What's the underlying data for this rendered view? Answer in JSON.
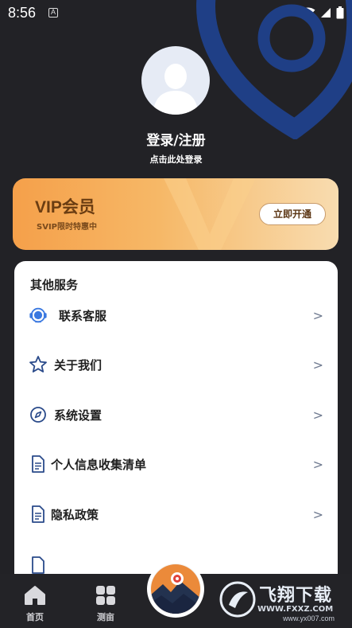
{
  "status": {
    "time": "8:56",
    "notification_icon": "A"
  },
  "profile": {
    "login_title": "登录/注册",
    "login_subtitle": "点击此处登录"
  },
  "vip": {
    "title": "VIP会员",
    "subtitle": "SVIP限时特惠中",
    "button": "立即开通"
  },
  "services": {
    "title": "其他服务",
    "items": [
      {
        "label": "联系客服",
        "icon": "headset-icon"
      },
      {
        "label": "关于我们",
        "icon": "star-icon"
      },
      {
        "label": "系统设置",
        "icon": "compass-icon"
      },
      {
        "label": "个人信息收集清单",
        "icon": "document-icon"
      },
      {
        "label": "隐私政策",
        "icon": "document-icon"
      }
    ],
    "chevron": ">"
  },
  "nav": {
    "home": "首页",
    "test": "测亩"
  },
  "watermark": {
    "brand": "飞翔下载",
    "url": "WWW.FXXZ.COM",
    "url2": "www.yx007.com"
  },
  "colors": {
    "background": "#222226",
    "vip_gradient_start": "#f5a04a",
    "vip_gradient_end": "#f8dcb0",
    "decor_blue": "#1f3f86",
    "chevron": "#6f7a90"
  }
}
